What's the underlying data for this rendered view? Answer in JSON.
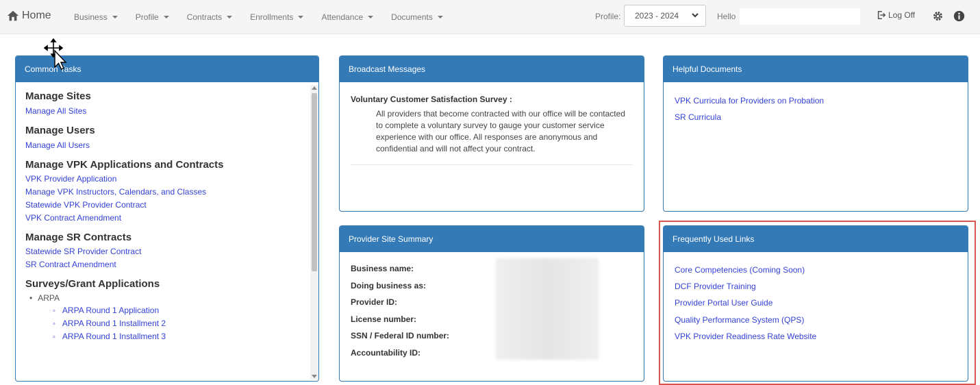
{
  "nav": {
    "home": "Home",
    "menu": [
      {
        "label": "Business"
      },
      {
        "label": "Profile"
      },
      {
        "label": "Contracts"
      },
      {
        "label": "Enrollments"
      },
      {
        "label": "Attendance"
      },
      {
        "label": "Documents"
      }
    ],
    "profile_label": "Profile:",
    "profile_value": "2023 - 2024",
    "hello_label": "Hello",
    "logoff": "Log Off"
  },
  "common_tasks": {
    "title": "Common Tasks",
    "sections": [
      {
        "heading": "Manage Sites",
        "links": [
          "Manage All Sites"
        ]
      },
      {
        "heading": "Manage Users",
        "links": [
          "Manage All Users"
        ]
      },
      {
        "heading": "Manage VPK Applications and Contracts",
        "links": [
          "VPK Provider Application",
          "Manage VPK Instructors, Calendars, and Classes",
          "Statewide VPK Provider Contract",
          "VPK Contract Amendment"
        ]
      },
      {
        "heading": "Manage SR Contracts",
        "links": [
          "Statewide SR Provider Contract",
          "SR Contract Amendment"
        ]
      },
      {
        "heading": "Surveys/Grant Applications",
        "links": []
      }
    ],
    "survey_group": "ARPA",
    "survey_links": [
      "ARPA Round 1 Application",
      "ARPA Round 1 Installment 2",
      "ARPA Round 1 Installment 3"
    ]
  },
  "broadcast": {
    "title": "Broadcast Messages",
    "message_title": "Voluntary Customer Satisfaction Survey :",
    "message_body": "All providers that become contracted with our office will be contacted to complete a voluntary survey to gauge your customer service experience with our office. All responses are anonymous and confidential and will not affect your contract."
  },
  "helpful": {
    "title": "Helpful Documents",
    "links": [
      "VPK Curricula for Providers on Probation",
      "SR Curricula"
    ]
  },
  "summary": {
    "title": "Provider Site Summary",
    "fields": [
      "Business name:",
      "Doing business as:",
      "Provider ID:",
      "License number:",
      "SSN / Federal ID number:",
      "Accountability ID:"
    ]
  },
  "frequent": {
    "title": "Frequently Used Links",
    "links": [
      "Core Competencies (Coming Soon)",
      "DCF Provider Training",
      "Provider Portal User Guide",
      "Quality Performance System (QPS)",
      "VPK Provider Readiness Rate Website"
    ]
  },
  "colors": {
    "panel_header": "#337ab7",
    "link": "#3342d6",
    "highlight": "#d9534f"
  },
  "icons": [
    "home-icon",
    "chevron-down-icon",
    "logoff-icon",
    "gear-icon",
    "info-icon",
    "move-cursor-icon"
  ]
}
